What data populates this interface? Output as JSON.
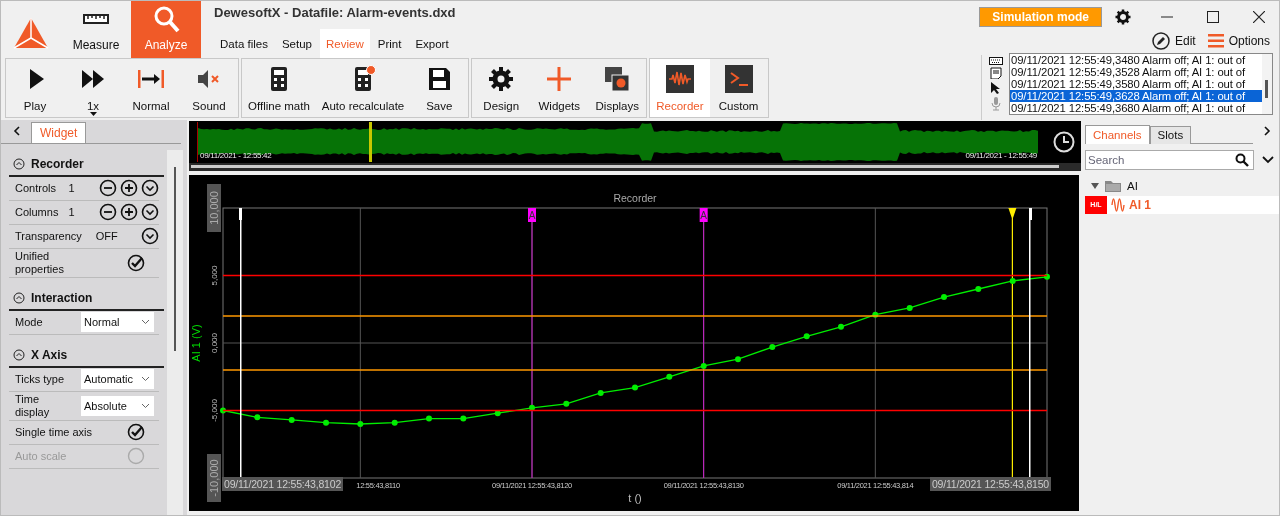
{
  "window": {
    "title": "DewesoftX - Datafile: Alarm-events.dxd"
  },
  "modes": [
    {
      "label": "Measure",
      "selected": false
    },
    {
      "label": "Analyze",
      "selected": true
    }
  ],
  "menu": [
    {
      "label": "Data files",
      "selected": false
    },
    {
      "label": "Setup",
      "selected": false
    },
    {
      "label": "Review",
      "selected": true
    },
    {
      "label": "Print",
      "selected": false
    },
    {
      "label": "Export",
      "selected": false
    }
  ],
  "simulation_badge": "Simulation mode",
  "header_actions": [
    "Edit",
    "Options"
  ],
  "toolbar": {
    "groups": [
      {
        "buttons": [
          {
            "label": "Play",
            "selected": false,
            "dropdown": false
          },
          {
            "label": "1x",
            "selected": false,
            "dropdown": true
          },
          {
            "label": "Normal",
            "selected": false,
            "dropdown": false
          },
          {
            "label": "Sound",
            "selected": false,
            "dropdown": false
          }
        ]
      },
      {
        "buttons": [
          {
            "label": "Offline math",
            "selected": false,
            "dropdown": false
          },
          {
            "label": "Auto recalculate",
            "selected": false,
            "dropdown": false
          },
          {
            "label": "Save",
            "selected": false,
            "dropdown": false
          }
        ]
      },
      {
        "buttons": [
          {
            "label": "Design",
            "selected": false,
            "dropdown": false
          },
          {
            "label": "Widgets",
            "selected": false,
            "dropdown": false
          },
          {
            "label": "Displays",
            "selected": false,
            "dropdown": false
          }
        ]
      },
      {
        "buttons": [
          {
            "label": "Recorder",
            "selected": true,
            "dropdown": false
          },
          {
            "label": "Custom",
            "selected": false,
            "dropdown": false
          }
        ]
      }
    ]
  },
  "event_log": {
    "entries": [
      {
        "text": "09/11/2021 12:55:49,3480 Alarm off; AI 1: out of",
        "selected": false
      },
      {
        "text": "09/11/2021 12:55:49,3528 Alarm off; AI 1: out of",
        "selected": false
      },
      {
        "text": "09/11/2021 12:55:49,3580 Alarm off; AI 1: out of",
        "selected": false
      },
      {
        "text": "09/11/2021 12:55:49,3628 Alarm off; AI 1: out of",
        "selected": true
      },
      {
        "text": "09/11/2021 12:55:49,3680 Alarm off; AI 1: out of",
        "selected": false
      }
    ]
  },
  "widget_panel": {
    "tab": "Widget",
    "sections": [
      {
        "title": "Recorder",
        "expanded": true,
        "rows": [
          {
            "kind": "counter",
            "label": "Controls",
            "value": "1",
            "disabled": false
          },
          {
            "kind": "counter",
            "label": "Columns",
            "value": "1",
            "disabled": false
          },
          {
            "kind": "option",
            "label": "Transparency",
            "value": "OFF",
            "disabled": false
          },
          {
            "kind": "check",
            "label": "Unified properties",
            "checked": true,
            "disabled": false
          }
        ]
      },
      {
        "title": "Interaction",
        "expanded": true,
        "rows": [
          {
            "kind": "select",
            "label": "Mode",
            "value": "Normal",
            "disabled": false
          }
        ]
      },
      {
        "title": "X Axis",
        "expanded": true,
        "rows": [
          {
            "kind": "select",
            "label": "Ticks type",
            "value": "Automatic",
            "disabled": false
          },
          {
            "kind": "select",
            "label": "Time display",
            "value": "Absolute",
            "disabled": false
          },
          {
            "kind": "check",
            "label": "Single time axis",
            "checked": true,
            "disabled": false
          },
          {
            "kind": "radio",
            "label": "Auto scale",
            "checked": false,
            "disabled": true
          }
        ]
      }
    ]
  },
  "overview": {
    "start": "09/11/2021 - 12:55:42",
    "end": "09/11/2021 - 12:55:49",
    "level": 0.205
  },
  "recorder": {
    "start_label": "09/11/2021 12:55:43,8102",
    "end_label": "09/11/2021 12:55:43,8150",
    "chart_data": {
      "type": "line",
      "title": "Recorder",
      "xlabel": "t ()",
      "ylabel": "AI 1 (V)",
      "categories": [
        null,
        null,
        null,
        null,
        "12:55:43,8110",
        null,
        null,
        null,
        null,
        "09/11/2021 12:55:43,8120",
        null,
        null,
        null,
        null,
        "09/11/2021 12:55:43,8130",
        null,
        null,
        null,
        null,
        "09/11/2021 12:55:43,814",
        null,
        null,
        null,
        null,
        null
      ],
      "series": [
        {
          "color": "#00ee00",
          "marker": true,
          "values": [
            -5000,
            -5500,
            -5700,
            -5900,
            -6000,
            -5900,
            -5600,
            -5600,
            -5200,
            -4800,
            -4500,
            -3700,
            -3300,
            -2500,
            -1700,
            -1200,
            -300,
            500,
            1200,
            2100,
            2600,
            3400,
            4000,
            4600,
            4900
          ]
        },
        {
          "color": "#ff0000",
          "marker": false,
          "values": [
            5000,
            5000,
            5000,
            5000,
            5000,
            5000,
            5000,
            5000,
            5000,
            5000,
            5000,
            5000,
            5000,
            5000,
            5000,
            5000,
            5000,
            5000,
            5000,
            5000,
            5000,
            5000,
            5000,
            5000,
            5000
          ]
        },
        {
          "color": "#ff0000",
          "marker": false,
          "values": [
            -5000,
            -5000,
            -5000,
            -5000,
            -5000,
            -5000,
            -5000,
            -5000,
            -5000,
            -5000,
            -5000,
            -5000,
            -5000,
            -5000,
            -5000,
            -5000,
            -5000,
            -5000,
            -5000,
            -5000,
            -5000,
            -5000,
            -5000,
            -5000,
            -5000
          ]
        },
        {
          "color": "#ff9900",
          "marker": false,
          "values": [
            2000,
            2000,
            2000,
            2000,
            2000,
            2000,
            2000,
            2000,
            2000,
            2000,
            2000,
            2000,
            2000,
            2000,
            2000,
            2000,
            2000,
            2000,
            2000,
            2000,
            2000,
            2000,
            2000,
            2000,
            2000
          ]
        },
        {
          "color": "#ff9900",
          "marker": false,
          "values": [
            -2000,
            -2000,
            -2000,
            -2000,
            -2000,
            -2000,
            -2000,
            -2000,
            -2000,
            -2000,
            -2000,
            -2000,
            -2000,
            -2000,
            -2000,
            -2000,
            -2000,
            -2000,
            -2000,
            -2000,
            -2000,
            -2000,
            -2000,
            -2000,
            -2000
          ]
        }
      ],
      "grid": true,
      "ylim": [
        -10000,
        10000
      ],
      "yticks": [
        {
          "value": 10000,
          "label": "10,000"
        },
        {
          "value": 5000,
          "label": "5,000"
        },
        {
          "value": 0,
          "label": "0,000"
        },
        {
          "value": -5000,
          "label": "-5,000"
        },
        {
          "value": -10000,
          "label": "-10,000"
        }
      ],
      "annotations": [
        {
          "x": "09/11/2021 12:55:43,8120",
          "text": "A"
        },
        {
          "x": "09/11/2021 12:55:43,8130",
          "text": "A"
        }
      ]
    },
    "cursors": [
      {
        "kind": "cursor",
        "level": 0.021
      },
      {
        "kind": "trigger",
        "level": 0.958
      },
      {
        "kind": "cursor",
        "level": 0.979
      }
    ]
  },
  "channels_panel": {
    "tabs": [
      {
        "label": "Channels",
        "selected": true
      },
      {
        "label": "Slots",
        "selected": false
      }
    ],
    "search": {
      "placeholder": "Search"
    },
    "tree": [
      {
        "label": "AI",
        "expanded": true,
        "children": [
          {
            "label": "AI 1",
            "badge": "H/L",
            "selected": true
          }
        ]
      }
    ]
  }
}
